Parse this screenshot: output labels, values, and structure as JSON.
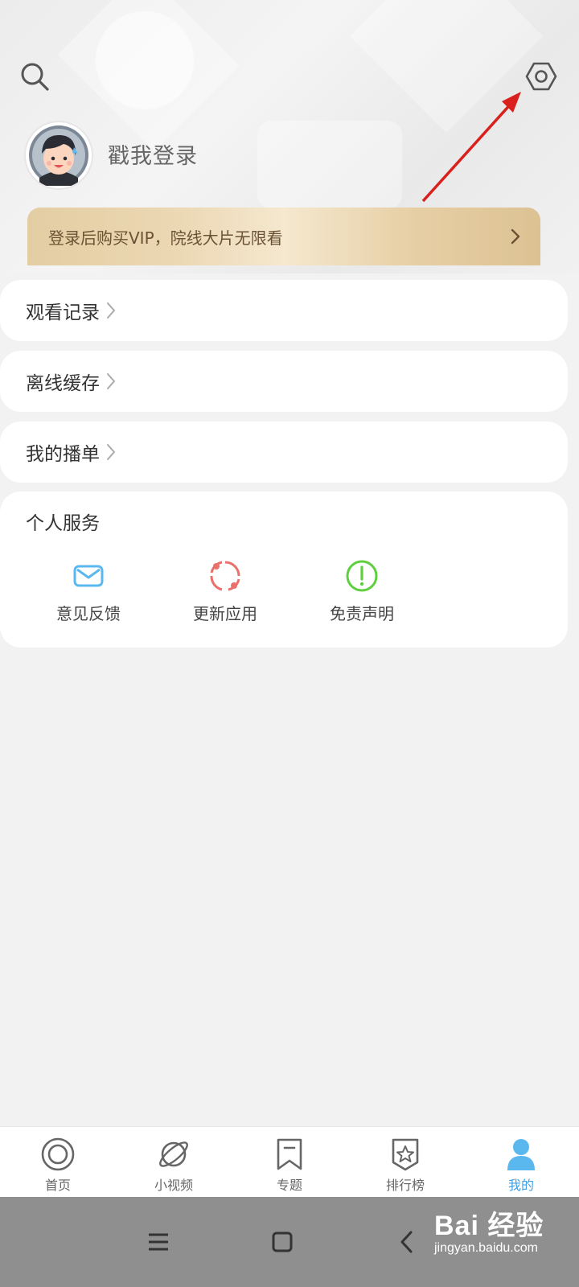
{
  "header": {
    "search_icon": "search-icon",
    "settings_icon": "settings-hexagon-icon",
    "login_text": "戳我登录"
  },
  "vip_banner": {
    "text": "登录后购买VIP，院线大片无限看"
  },
  "menu": [
    {
      "label": "观看记录"
    },
    {
      "label": "离线缓存"
    },
    {
      "label": "我的播单"
    }
  ],
  "services": {
    "title": "个人服务",
    "items": [
      {
        "label": "意见反馈",
        "icon": "mail-icon",
        "color": "#5bb8ee"
      },
      {
        "label": "更新应用",
        "icon": "refresh-icon",
        "color": "#e9706b"
      },
      {
        "label": "免责声明",
        "icon": "exclamation-circle-icon",
        "color": "#5fcf3e"
      }
    ]
  },
  "tabbar": {
    "items": [
      {
        "label": "首页",
        "icon": "home-circle-icon"
      },
      {
        "label": "小视频",
        "icon": "planet-icon"
      },
      {
        "label": "专题",
        "icon": "bookmark-icon"
      },
      {
        "label": "排行榜",
        "icon": "star-shield-icon"
      },
      {
        "label": "我的",
        "icon": "user-icon",
        "active": true
      }
    ],
    "active_color": "#3aa1e8"
  },
  "system_nav": {
    "watermark_main": "Bai 经验",
    "watermark_sub": "jingyan.baidu.com"
  }
}
